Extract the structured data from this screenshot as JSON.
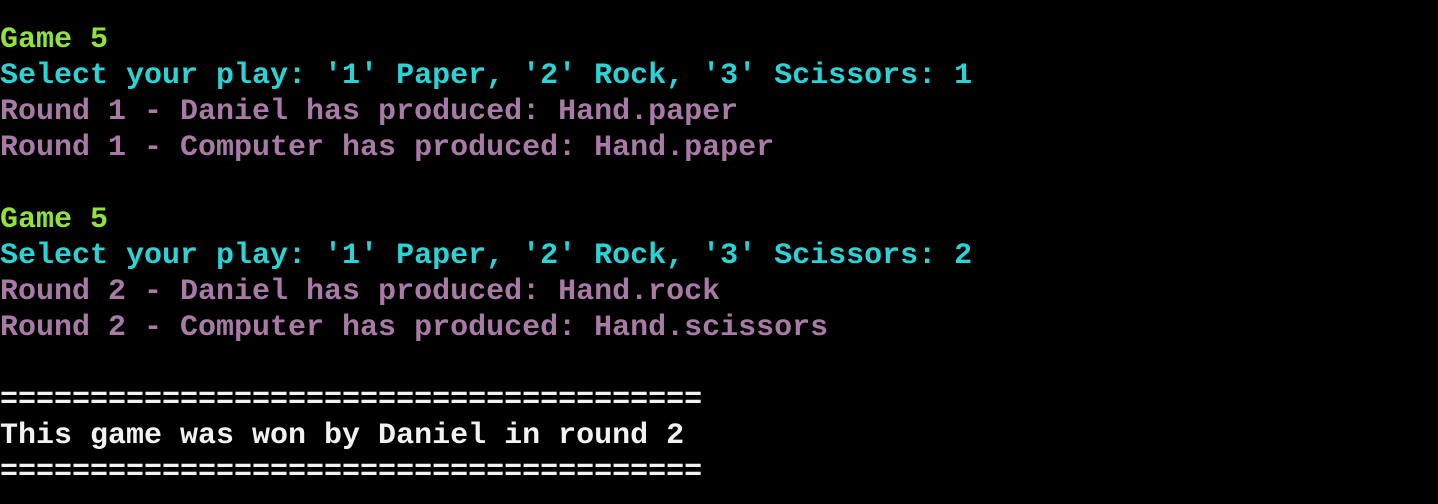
{
  "terminal": {
    "blocks": [
      {
        "game": "Game 5",
        "prompt": "Select your play: '1' Paper, '2' Rock, '3' Scissors: 1",
        "player_round": "Round 1 - Daniel has produced: Hand.paper",
        "computer_round": "Round 1 - Computer has produced: Hand.paper"
      },
      {
        "game": "Game 5",
        "prompt": "Select your play: '1' Paper, '2' Rock, '3' Scissors: 2",
        "player_round": "Round 2 - Daniel has produced: Hand.rock",
        "computer_round": "Round 2 - Computer has produced: Hand.scissors"
      }
    ],
    "separator_top": "=======================================",
    "result": "This game was won by Daniel in round 2",
    "separator_bottom": "=======================================",
    "colors": {
      "background": "#000000",
      "game": "#8fe33b",
      "prompt": "#2ad4d6",
      "round": "#a97aa6",
      "result": "#f2f2f2"
    }
  }
}
